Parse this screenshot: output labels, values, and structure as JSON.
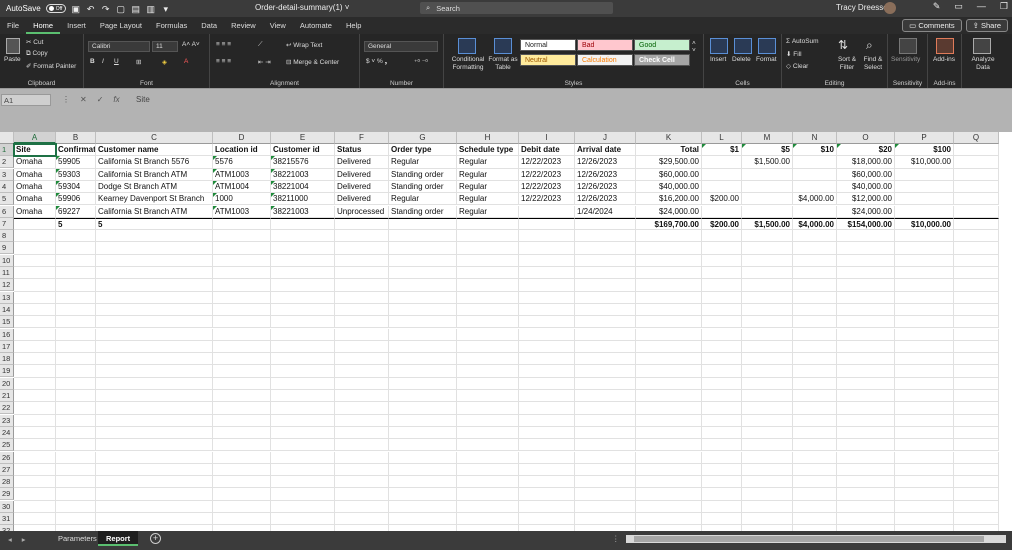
{
  "titlebar": {
    "autosave_label": "AutoSave",
    "autosave_state": "Off",
    "doc_title": "Order-detail-summary(1) ˅",
    "search_placeholder": "Search",
    "user_name": "Tracy Dreessen"
  },
  "menu": {
    "items": [
      "File",
      "Home",
      "Insert",
      "Page Layout",
      "Formulas",
      "Data",
      "Review",
      "View",
      "Automate",
      "Help"
    ],
    "active": "Home",
    "comments_label": "Comments",
    "share_label": "Share"
  },
  "ribbon": {
    "clipboard": {
      "paste": "Paste",
      "cut": "Cut",
      "copy": "Copy",
      "format_painter": "Format Painter",
      "label": "Clipboard"
    },
    "font": {
      "name": "Calibri",
      "size": "11",
      "label": "Font"
    },
    "alignment": {
      "wrap": "Wrap Text",
      "merge": "Merge & Center",
      "label": "Alignment"
    },
    "number": {
      "format": "General",
      "label": "Number"
    },
    "styles": {
      "conditional": "Conditional Formatting",
      "format_table": "Format as Table",
      "cells": [
        {
          "name": "Normal",
          "bg": "#ffffff",
          "fg": "#222222"
        },
        {
          "name": "Bad",
          "bg": "#ffc7ce",
          "fg": "#9c0006"
        },
        {
          "name": "Good",
          "bg": "#c6efce",
          "fg": "#006100"
        },
        {
          "name": "Neutral",
          "bg": "#ffeb9c",
          "fg": "#9c5700"
        },
        {
          "name": "Calculation",
          "bg": "#f2f2f2",
          "fg": "#fa7d00"
        },
        {
          "name": "Check Cell",
          "bg": "#a5a5a5",
          "fg": "#ffffff"
        }
      ],
      "label": "Styles"
    },
    "cells": {
      "insert": "Insert",
      "delete": "Delete",
      "format": "Format",
      "label": "Cells"
    },
    "editing": {
      "autosum": "AutoSum",
      "fill": "Fill",
      "clear": "Clear",
      "sort": "Sort & Filter",
      "find": "Find & Select",
      "label": "Editing"
    },
    "sensitivity": {
      "button": "Sensitivity",
      "label": "Sensitivity"
    },
    "addins": {
      "button": "Add-ins",
      "label": "Add-ins"
    },
    "analyze": {
      "button": "Analyze Data"
    }
  },
  "formula_bar": {
    "name_box": "A1",
    "content": "Site"
  },
  "sheet": {
    "columns": [
      "A",
      "B",
      "C",
      "D",
      "E",
      "F",
      "G",
      "H",
      "I",
      "J",
      "K",
      "L",
      "M",
      "N",
      "O",
      "P",
      "Q"
    ],
    "header_row": [
      "Site",
      "Confirmation",
      "Customer name",
      "Location id",
      "Customer id",
      "Status",
      "Order type",
      "Schedule type",
      "Debit date",
      "Arrival date",
      "Total",
      "$1",
      "$5",
      "$10",
      "$20",
      "$100",
      ""
    ],
    "rows": [
      [
        "Omaha",
        "59905",
        "California St Branch 5576",
        "5576",
        "38215576",
        "Delivered",
        "Regular",
        "Regular",
        "12/22/2023",
        "12/26/2023",
        "$29,500.00",
        "",
        "$1,500.00",
        "",
        "$18,000.00",
        "$10,000.00",
        ""
      ],
      [
        "Omaha",
        "59303",
        "California St Branch ATM",
        "ATM1003",
        "38221003",
        "Delivered",
        "Standing order",
        "Regular",
        "12/22/2023",
        "12/26/2023",
        "$60,000.00",
        "",
        "",
        "",
        "$60,000.00",
        "",
        ""
      ],
      [
        "Omaha",
        "59304",
        "Dodge St Branch ATM",
        "ATM1004",
        "38221004",
        "Delivered",
        "Standing order",
        "Regular",
        "12/22/2023",
        "12/26/2023",
        "$40,000.00",
        "",
        "",
        "",
        "$40,000.00",
        "",
        ""
      ],
      [
        "Omaha",
        "59906",
        "Kearney Davenport St Branch",
        "1000",
        "38211000",
        "Delivered",
        "Regular",
        "Regular",
        "12/22/2023",
        "12/26/2023",
        "$16,200.00",
        "$200.00",
        "",
        "$4,000.00",
        "$12,000.00",
        "",
        ""
      ],
      [
        "Omaha",
        "69227",
        "California St Branch ATM",
        "ATM1003",
        "38221003",
        "Unprocessed",
        "Standing order",
        "Regular",
        "",
        "1/24/2024",
        "$24,000.00",
        "",
        "",
        "",
        "$24,000.00",
        "",
        ""
      ]
    ],
    "totals_row": [
      "",
      "5",
      "5",
      "",
      "",
      "",
      "",
      "",
      "",
      "",
      "$169,700.00",
      "$200.00",
      "$1,500.00",
      "$4,000.00",
      "$154,000.00",
      "$10,000.00",
      ""
    ],
    "row_numbers": [
      "1",
      "2",
      "3",
      "4",
      "5",
      "6",
      "7",
      "8",
      "9",
      "10",
      "11",
      "12",
      "13",
      "14",
      "15",
      "16",
      "17",
      "18",
      "19",
      "20",
      "21",
      "22",
      "23",
      "24",
      "25",
      "26",
      "27",
      "28",
      "29",
      "30",
      "31",
      "32"
    ]
  },
  "tabs": {
    "sheets": [
      "Parameters",
      "Report"
    ],
    "active": "Report"
  }
}
